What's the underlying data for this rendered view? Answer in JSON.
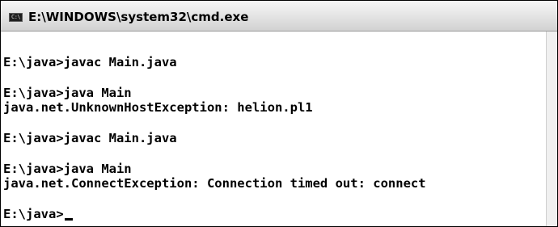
{
  "window": {
    "title": "E:\\WINDOWS\\system32\\cmd.exe",
    "icon": "cmd-console-icon",
    "icon_glyph": "C:\\"
  },
  "console": {
    "lines": [
      "E:\\java>javac Main.java",
      "E:\\java>java Main",
      "java.net.UnknownHostException: helion.pl1",
      "E:\\java>javac Main.java",
      "E:\\java>java Main",
      "java.net.ConnectException: Connection timed out: connect",
      "E:\\java>"
    ]
  },
  "colors": {
    "background": "#ffffff",
    "text": "#000000",
    "titlebar": "#e6e6e6"
  }
}
